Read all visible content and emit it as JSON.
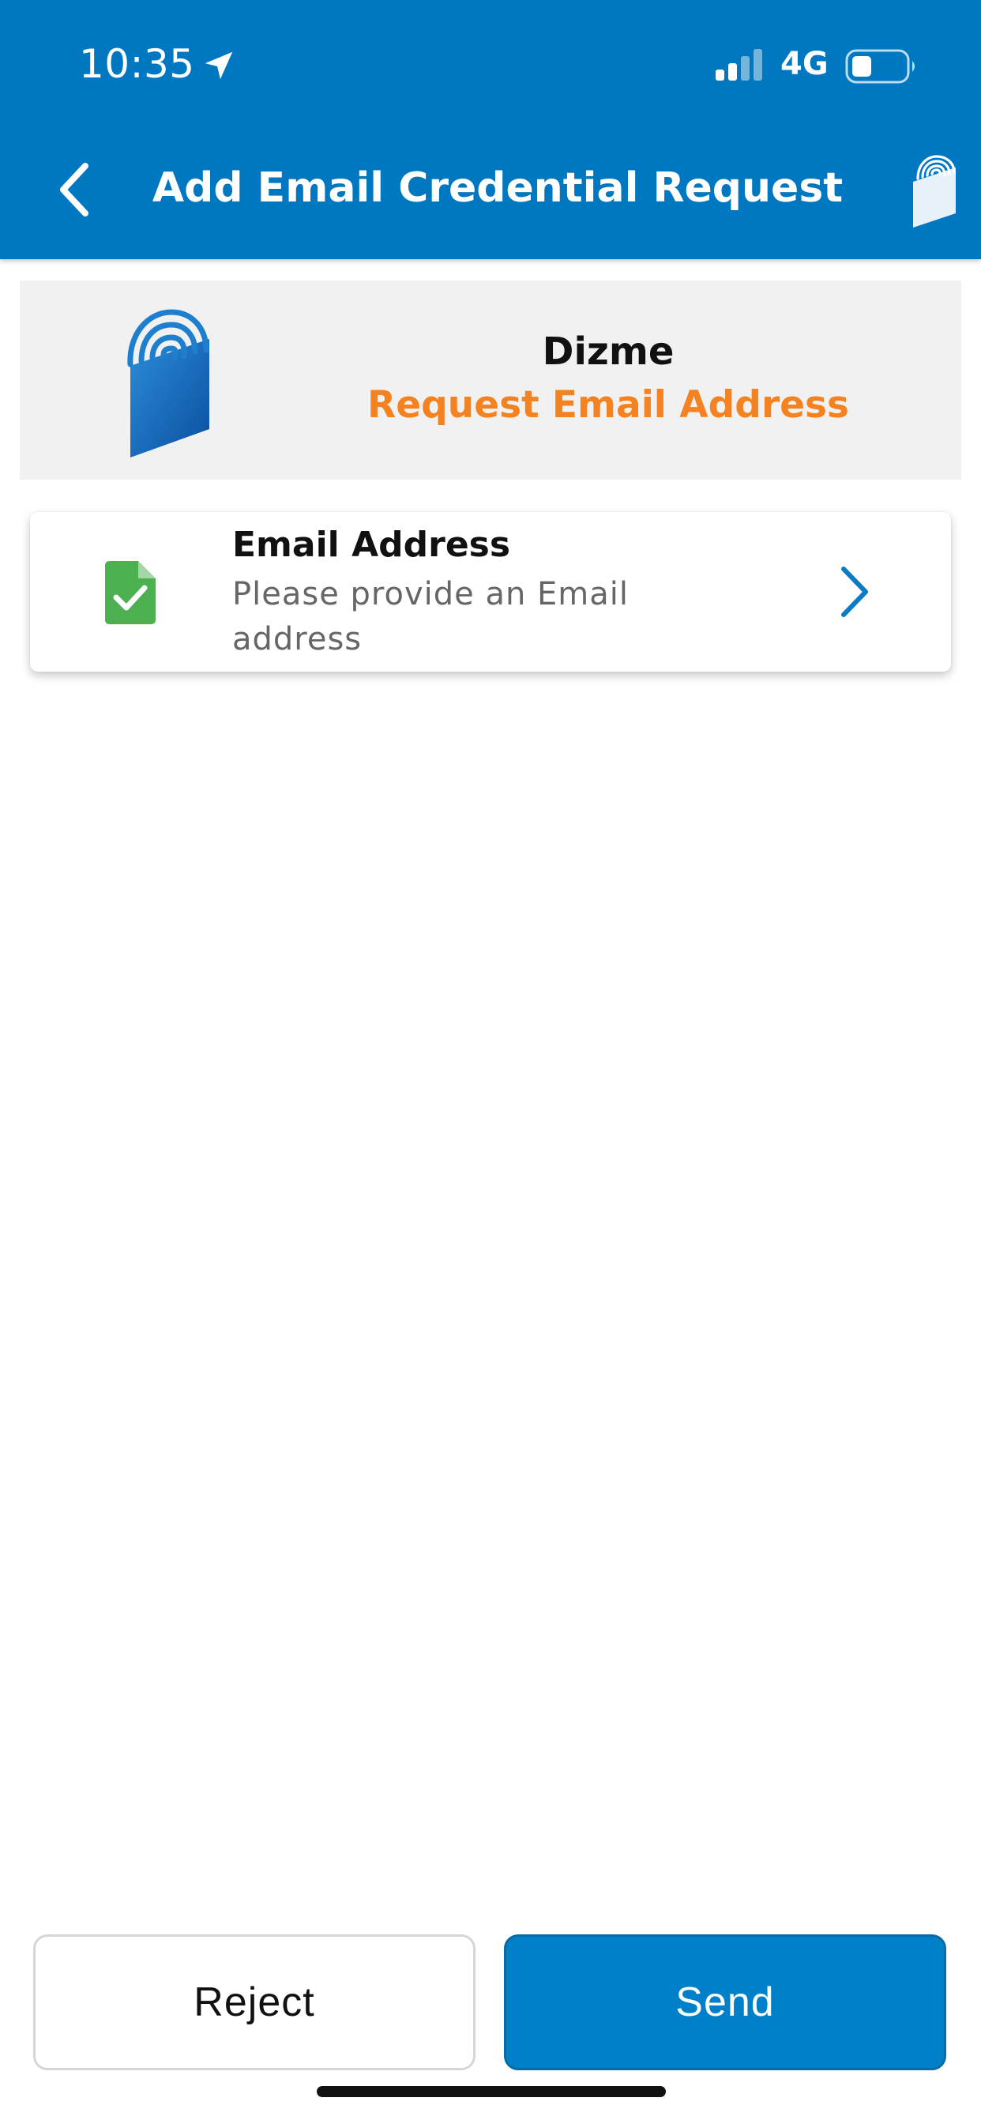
{
  "status_bar": {
    "time": "10:35",
    "network": "4G",
    "icons": [
      "location-arrow-icon",
      "signal-bars-icon",
      "battery-icon"
    ]
  },
  "header": {
    "title": "Add Email Credential Request",
    "back_icon": "chevron-left-icon",
    "logo_icon": "dizme-logo-icon"
  },
  "issuer": {
    "name": "Dizme",
    "request_label": "Request Email Address",
    "logo_icon": "dizme-logo-icon"
  },
  "credentials": [
    {
      "title": "Email Address",
      "description": "Please provide an Email address",
      "status_icon": "document-check-icon",
      "action_icon": "chevron-right-icon"
    }
  ],
  "actions": {
    "reject_label": "Reject",
    "send_label": "Send"
  },
  "colors": {
    "primary": "#0078C1",
    "accent_orange": "#F58220",
    "success_green": "#4CAF50",
    "card_background": "#F1F1F1"
  }
}
